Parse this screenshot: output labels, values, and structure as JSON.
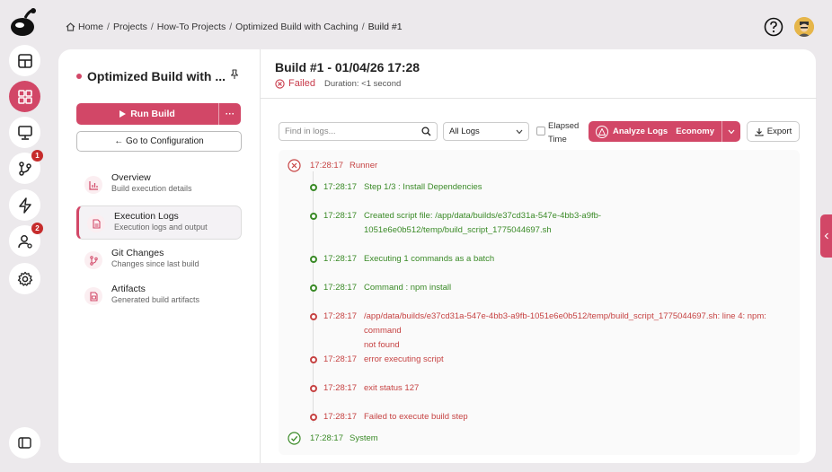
{
  "breadcrumb": {
    "items": [
      "Home",
      "Projects",
      "How-To Projects",
      "Optimized Build with Caching",
      "Build #1"
    ]
  },
  "rail": {
    "badges": {
      "branches": "1",
      "users": "2"
    }
  },
  "project": {
    "title": "Optimized Build with ...",
    "run_label": "Run Build",
    "more_label": "···",
    "goto_label": "← Go to Configuration"
  },
  "nav": [
    {
      "title": "Overview",
      "subtitle": "Build execution details"
    },
    {
      "title": "Execution Logs",
      "subtitle": "Execution logs and output"
    },
    {
      "title": "Git Changes",
      "subtitle": "Changes since last build"
    },
    {
      "title": "Artifacts",
      "subtitle": "Generated build artifacts"
    }
  ],
  "build": {
    "title": "Build #1 - 01/04/26 17:28",
    "status": "Failed",
    "duration": "Duration: <1 second"
  },
  "toolbar": {
    "search_placeholder": "Find in logs...",
    "filter_value": "All Logs",
    "elapsed_line1": "Elapsed",
    "elapsed_line2": "Time",
    "analyze_label": "Analyze Logs",
    "analyze_mode": "Economy",
    "export_label": "Export"
  },
  "logs": {
    "runner": {
      "ts": "17:28:17",
      "msg": "Runner"
    },
    "entries": [
      {
        "ts": "17:28:17",
        "msg": "Step 1/3 : Install Dependencies",
        "level": "ok"
      },
      {
        "ts": "17:28:17",
        "msg": "Created script file: /app/data/builds/e37cd31a-547e-4bb3-a9fb-",
        "msg2": "1051e6e0b512/temp/build_script_1775044697.sh",
        "level": "ok"
      },
      {
        "ts": "17:28:17",
        "msg": "Executing 1 commands as a batch",
        "level": "ok"
      },
      {
        "ts": "17:28:17",
        "msg": "Command : npm install",
        "level": "ok"
      },
      {
        "ts": "17:28:17",
        "msg": "/app/data/builds/e37cd31a-547e-4bb3-a9fb-1051e6e0b512/temp/build_script_1775044697.sh: line 4: npm:",
        "msg2": "command not found",
        "level": "err"
      },
      {
        "ts": "17:28:17",
        "msg": "error executing script",
        "level": "err"
      },
      {
        "ts": "17:28:17",
        "msg": "exit status 127",
        "level": "err"
      },
      {
        "ts": "17:28:17",
        "msg": "Failed to execute build step",
        "level": "err"
      }
    ],
    "system": {
      "ts": "17:28:17",
      "msg": "System"
    }
  },
  "colors": {
    "accent": "#d24767",
    "ok": "#3a8a27",
    "err": "#c64343"
  }
}
